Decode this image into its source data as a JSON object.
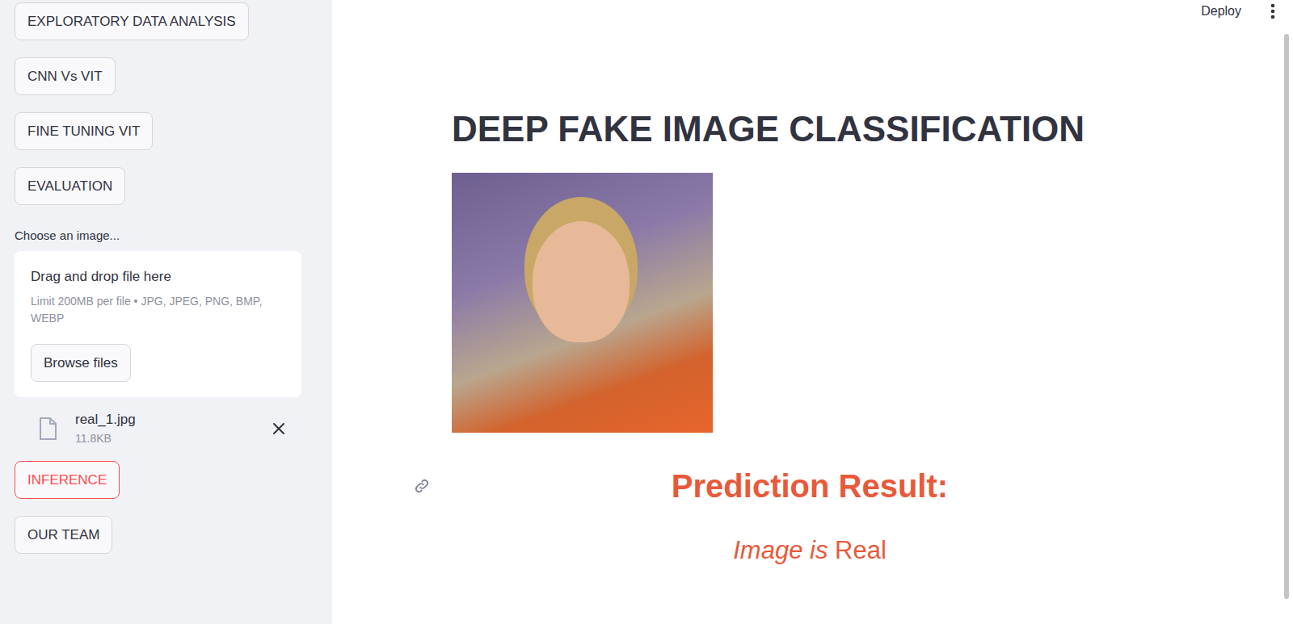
{
  "header": {
    "deploy": "Deploy"
  },
  "sidebar": {
    "nav_top": [
      {
        "label": "EXPLORATORY DATA ANALYSIS",
        "selected": false
      },
      {
        "label": "CNN Vs VIT",
        "selected": false
      },
      {
        "label": "FINE TUNING VIT",
        "selected": false
      },
      {
        "label": "EVALUATION",
        "selected": false
      }
    ],
    "uploader": {
      "label": "Choose an image...",
      "drop_text": "Drag and drop file here",
      "limit_text": "Limit 200MB per file • JPG, JPEG, PNG, BMP, WEBP",
      "button": "Browse files",
      "file": {
        "name": "real_1.jpg",
        "size": "11.8KB"
      }
    },
    "nav_bottom": [
      {
        "label": "INFERENCE",
        "selected": true
      },
      {
        "label": "OUR TEAM",
        "selected": false
      }
    ]
  },
  "main": {
    "title": "DEEP FAKE IMAGE CLASSIFICATION",
    "result": {
      "heading": "Prediction Result:",
      "prefix": "Image is",
      "value": "Real"
    }
  }
}
